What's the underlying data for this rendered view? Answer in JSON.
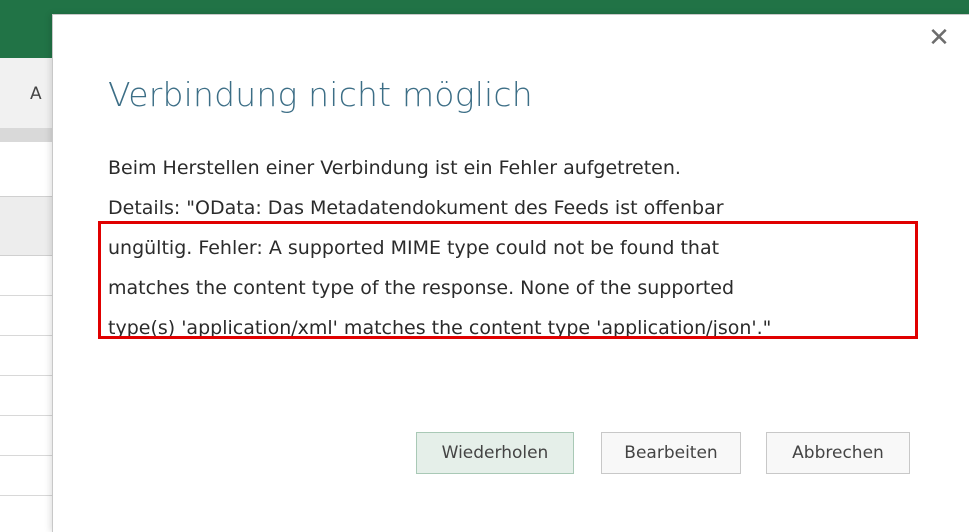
{
  "excel": {
    "column_letter": "A"
  },
  "dialog": {
    "close_symbol": "✕",
    "title": "Verbindung nicht möglich",
    "line1": "Beim Herstellen einer Verbindung ist ein Fehler aufgetreten.",
    "line2": "Details: \"OData: Das Metadatendokument des Feeds ist offenbar",
    "line3": "ungültig. Fehler: A supported MIME type could not be found that",
    "line4": "matches the content type of the response. None of the supported",
    "line5": "type(s) 'application/xml' matches the content type 'application/json'.\"",
    "buttons": {
      "retry": "Wiederholen",
      "edit": "Bearbeiten",
      "cancel": "Abbrechen"
    }
  },
  "colors": {
    "ribbon": "#217346",
    "title": "#3c6e86",
    "highlight": "#e00000"
  }
}
